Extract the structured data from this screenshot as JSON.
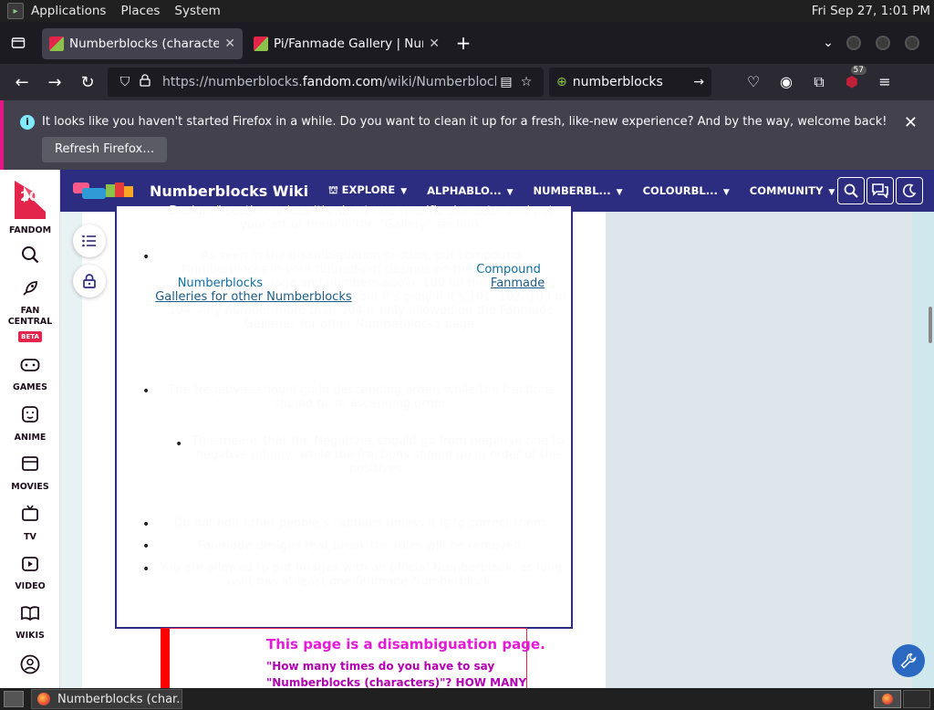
{
  "top_panel": {
    "menus": [
      "Applications",
      "Places",
      "System"
    ],
    "clock": "Fri Sep 27,  1:01 PM"
  },
  "tabs": [
    {
      "title": "Numberblocks (characters)/F",
      "active": true
    },
    {
      "title": "Pi/Fanmade Gallery | Numbe",
      "active": false
    }
  ],
  "navbar": {
    "url_prefix": "https://numberblocks.",
    "url_domain": "fandom.com",
    "url_suffix": "/wiki/Numberblocks_",
    "search_value": "numberblocks",
    "extensions_badge": "57"
  },
  "notification": {
    "message": "It looks like you haven't started Firefox in a while. Do you want to clean it up for a fresh, like-new experience? And by the way, welcome back!",
    "button": "Refresh Firefox…"
  },
  "fandom_rail": {
    "logo_number": "20",
    "items": [
      "FANDOM",
      "FAN CENTRAL",
      "GAMES",
      "ANIME",
      "MOVIES",
      "TV",
      "VIDEO",
      "WIKIS"
    ],
    "beta": "BETA"
  },
  "wiki_header": {
    "name": "Numberblocks Wiki",
    "nav": [
      "EXPLORE",
      "ALPHABLO...",
      "NUMBERBL...",
      "COLOURBL...",
      "COMMUNITY"
    ]
  },
  "rules": {
    "r0_line1": "Designs\" section unless it's about one specific character and put",
    "r0_line2": "your art of them in the \"Gallery\" section.",
    "r1_line1": "As seen in the disambiguation section, put compound",
    "r1_line2": "Numberblocks in your figured-out designs on the ",
    "r1_link1a": "Compound",
    "r1_link1b": "Numberblocks",
    "r1_line3": " page and numbers above 100 on the ",
    "r1_link2a": "Fanmade",
    "r1_link2b": "Galleries for other Numberblocks",
    "r1_line4": ", but it's okay if it's 101, 102, 103 or",
    "r1_line5": "104. Any number more than 104 is only allowed on the Fanmade",
    "r1_line6": "Galleries for other Numberblocks page.",
    "r2_line1": "The Negatives should go in descending order, while the fractions",
    "r2_line2": "should go in ascending order.",
    "r3_line1": "This means that the Negatives should go from negative one to",
    "r3_line2": "negative infinity, while the fractions should go in order of the",
    "r3_line3": "positives.",
    "r4": "Do not edit other people's captions unless it is to correct them.",
    "r5": "Fanmade designs that break the rules will be removed.",
    "r6_line1": "You are allowed to put images with an official Numberblock, as long",
    "r6_line2": "as it has at least one fanmade Numberblock."
  },
  "disambiguation": {
    "title": "This page is a disambiguation page.",
    "line1": "\"How many times do you have to say",
    "line2": "\"Numberblocks (characters)\"? HOW MANY"
  },
  "taskbar": {
    "task": "Numberblocks (char..."
  },
  "colors": {
    "wiki_header": "#2c2d80",
    "fandom_red": "#e4254b",
    "link_blue": "#0f6fa6",
    "notif_accent": "#e31587",
    "disambig_title": "#e31ad8"
  }
}
